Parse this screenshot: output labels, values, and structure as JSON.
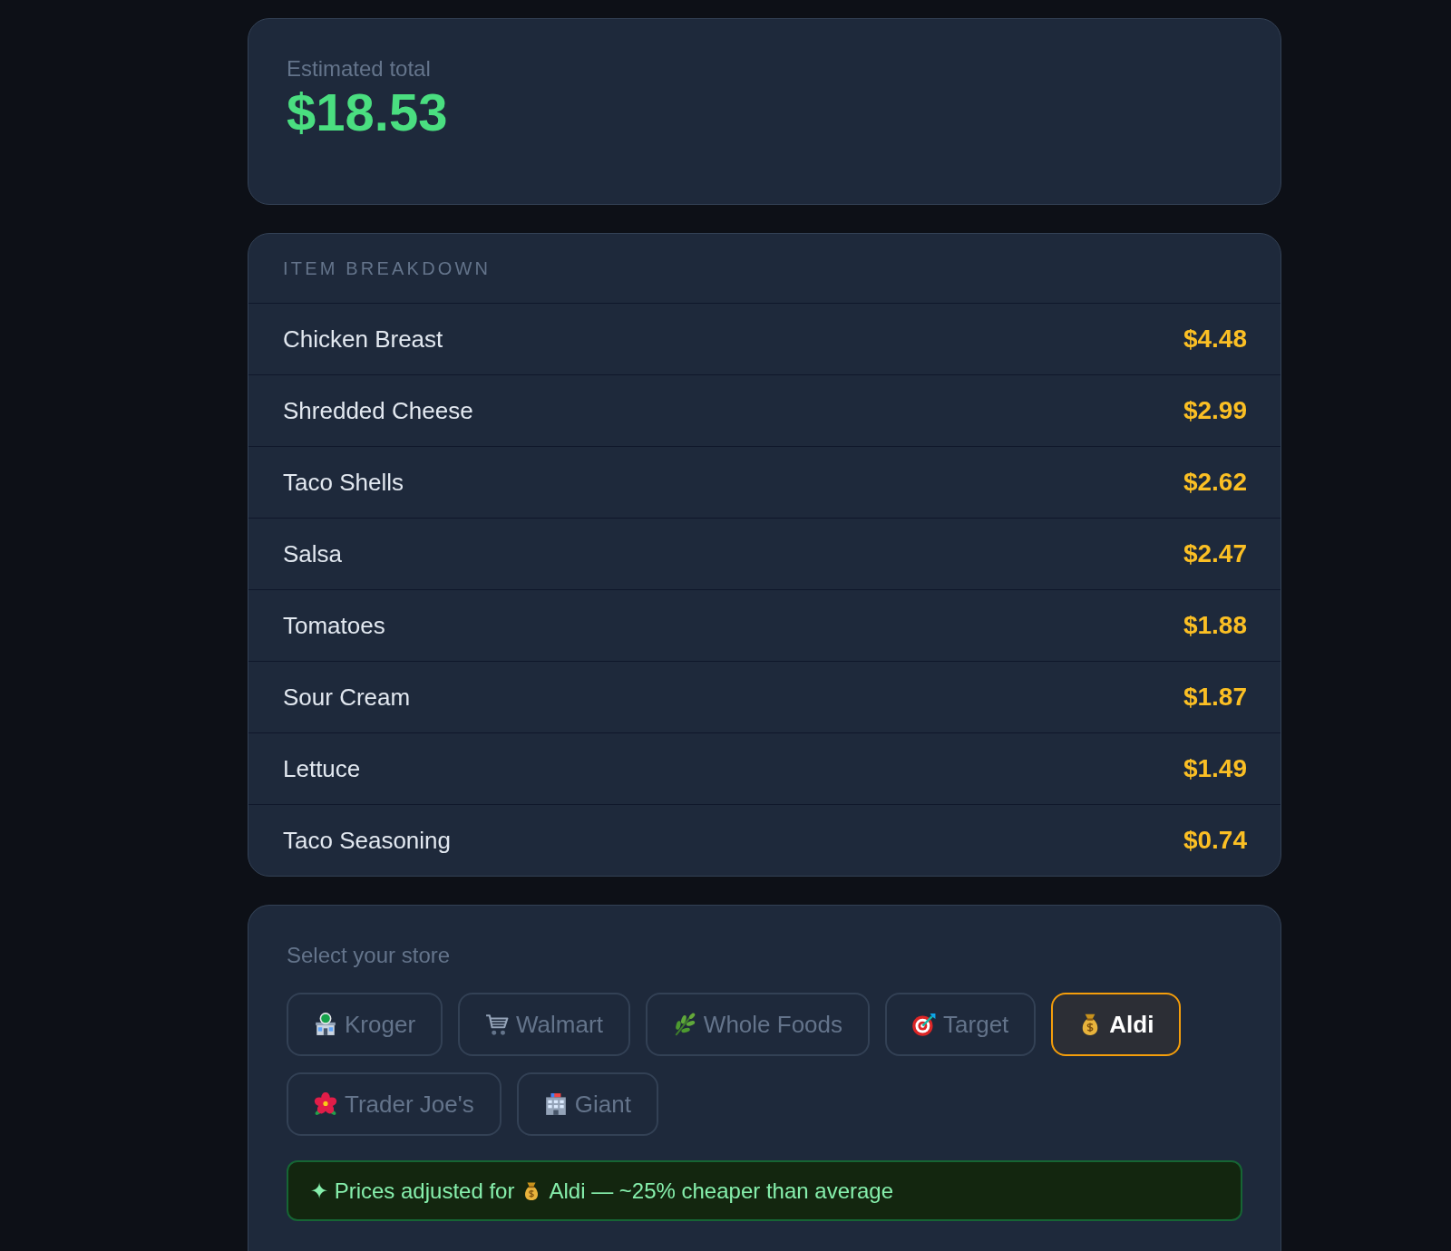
{
  "summary": {
    "label": "Estimated total",
    "total": "$18.53"
  },
  "breakdown": {
    "title": "ITEM BREAKDOWN",
    "items": [
      {
        "name": "Chicken Breast",
        "price": "$4.48"
      },
      {
        "name": "Shredded Cheese",
        "price": "$2.99"
      },
      {
        "name": "Taco Shells",
        "price": "$2.62"
      },
      {
        "name": "Salsa",
        "price": "$2.47"
      },
      {
        "name": "Tomatoes",
        "price": "$1.88"
      },
      {
        "name": "Sour Cream",
        "price": "$1.87"
      },
      {
        "name": "Lettuce",
        "price": "$1.49"
      },
      {
        "name": "Taco Seasoning",
        "price": "$0.74"
      }
    ]
  },
  "store_picker": {
    "label": "Select your store",
    "stores": [
      {
        "name": "Kroger",
        "kind": "shop",
        "selected": false
      },
      {
        "name": "Walmart",
        "kind": "cart",
        "selected": false
      },
      {
        "name": "Whole Foods",
        "kind": "herb",
        "selected": false
      },
      {
        "name": "Target",
        "kind": "target",
        "selected": false
      },
      {
        "name": "Aldi",
        "kind": "moneybag",
        "selected": true
      },
      {
        "name": "Trader Joe's",
        "kind": "flower",
        "selected": false
      },
      {
        "name": "Giant",
        "kind": "building",
        "selected": false
      }
    ]
  },
  "banner": {
    "text_before": "✦ Prices adjusted for",
    "kind": "moneybag",
    "text_after": "Aldi — ~25% cheaper than average"
  }
}
